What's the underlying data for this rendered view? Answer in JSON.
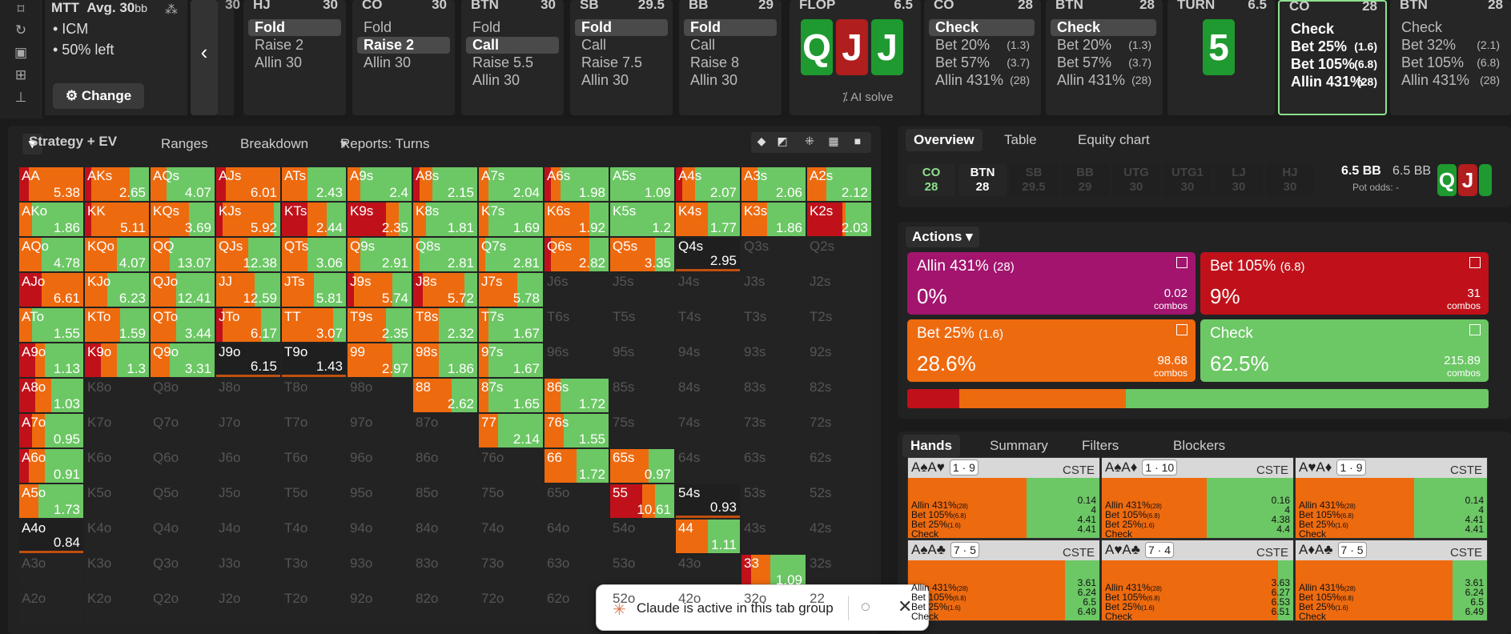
{
  "topbar": {
    "mtt": {
      "title": "MTT",
      "avg": "Avg. 30",
      "avg_unit": "bb",
      "bullets": [
        "• ICM",
        "• 50% left"
      ],
      "change": "Change"
    },
    "nav_stack": "30",
    "columns": [
      {
        "pos": "HJ",
        "stack": "30",
        "actions": [
          {
            "t": "Fold",
            "sel": true
          },
          {
            "t": "Raise 2"
          },
          {
            "t": "Allin 30"
          }
        ]
      },
      {
        "pos": "CO",
        "stack": "30",
        "actions": [
          {
            "t": "Fold"
          },
          {
            "t": "Raise 2",
            "sel": true
          },
          {
            "t": "Allin 30"
          }
        ]
      },
      {
        "pos": "BTN",
        "stack": "30",
        "actions": [
          {
            "t": "Fold"
          },
          {
            "t": "Call",
            "sel": true
          },
          {
            "t": "Raise 5.5"
          },
          {
            "t": "Allin 30"
          }
        ]
      },
      {
        "pos": "SB",
        "stack": "29.5",
        "actions": [
          {
            "t": "Fold",
            "sel": true
          },
          {
            "t": "Call"
          },
          {
            "t": "Raise 7.5"
          },
          {
            "t": "Allin 30"
          }
        ]
      },
      {
        "pos": "BB",
        "stack": "29",
        "actions": [
          {
            "t": "Fold",
            "sel": true
          },
          {
            "t": "Call"
          },
          {
            "t": "Raise 8"
          },
          {
            "t": "Allin 30"
          }
        ]
      }
    ],
    "flop": {
      "label": "FLOP",
      "pot": "6.5",
      "cards": [
        {
          "r": "Q",
          "c": "#1e9a30"
        },
        {
          "r": "J",
          "c": "#b01e1e"
        },
        {
          "r": "J",
          "c": "#1e9a30"
        }
      ],
      "ai": "AI solve"
    },
    "postflop": [
      {
        "pos": "CO",
        "stack": "28",
        "actions": [
          {
            "t": "Check",
            "sel": true
          },
          {
            "t": "Bet 20%",
            "s": "(1.3)"
          },
          {
            "t": "Bet 57%",
            "s": "(3.7)"
          },
          {
            "t": "Allin 431%",
            "s": "(28)"
          }
        ]
      },
      {
        "pos": "BTN",
        "stack": "28",
        "actions": [
          {
            "t": "Check",
            "sel": true
          },
          {
            "t": "Bet 20%",
            "s": "(1.3)"
          },
          {
            "t": "Bet 57%",
            "s": "(3.7)"
          },
          {
            "t": "Allin 431%",
            "s": "(28)"
          }
        ]
      }
    ],
    "turn": {
      "label": "TURN",
      "pot": "6.5",
      "card": "5",
      "color": "#1e9a30"
    },
    "active": {
      "pos": "CO",
      "stack": "28",
      "actions": [
        {
          "t": "Check"
        },
        {
          "t": "Bet 25%",
          "s": "(1.6)"
        },
        {
          "t": "Bet 105%",
          "s": "(6.8)"
        },
        {
          "t": "Allin 431%",
          "s": "(28)"
        }
      ]
    },
    "last": {
      "pos": "BTN",
      "stack": "28",
      "actions": [
        {
          "t": "Check"
        },
        {
          "t": "Bet 32%",
          "s": "(2.1)"
        },
        {
          "t": "Bet 105%",
          "s": "(6.8)"
        },
        {
          "t": "Allin 431%",
          "s": "(28)"
        }
      ]
    }
  },
  "grid_tabs": {
    "strategy": "Strategy + EV",
    "ranges": "Ranges",
    "breakdown": "Breakdown",
    "reports": "Reports: Turns"
  },
  "grid": [
    [
      "AA|5.38|r15o85",
      "AKs|2.65|r10o60g30",
      "AQs|4.07|o25g75",
      "AJs|6.01|r15o85",
      "ATs|2.43|o40g60",
      "A9s|2.4|o20g80",
      "A8s|2.15|r10o20g70",
      "A7s|2.04|o15g85",
      "A6s|1.98|r10o15g75",
      "A5s|1.09|g100",
      "A4s|2.07|r10o20g70",
      "A3s|2.06|o25g75",
      "A2s|2.12|o30g70"
    ],
    [
      "AKo|1.86|o20g80",
      "KK|5.11|r10o90",
      "KQs|3.69|o60g40",
      "KJs|5.92|r10o80g10",
      "KTs|2.44|r40o30g30",
      "K9s|2.35|r60o20g20",
      "K8s|1.81|o20g80",
      "K7s|1.69|o15g85",
      "K6s|1.92|o70g30",
      "K5s|1.2|g100",
      "K4s|1.77|o50g50",
      "K3s|1.86|o40g60",
      "K2s|2.03|r55o5g40"
    ],
    [
      "AQo|4.78|o35g65",
      "KQo|4.07|o50g50",
      "QQ|13.07|o30g70",
      "QJs|12.38|o50g50",
      "QTs|3.06|o40g60",
      "Q9s|2.91|o20g80",
      "Q8s|2.81|o10g90",
      "Q7s|2.81|o10g90",
      "Q6s|2.82|r10o60g30",
      "Q5s|3.35|o70g30",
      "Q4s|2.95|d",
      "Q3s||e",
      "Q2s||e"
    ],
    [
      "AJo|6.61|r35o65",
      "KJo|6.23|o35g65",
      "QJo|12.41|o40g60",
      "JJ|12.59|o60g40",
      "JTs|5.81|o50g50",
      "J9s|5.74|r10o60g30",
      "J8s|5.72|r15o65g20",
      "J7s|5.78|o60g40",
      "J6s||e",
      "J5s||e",
      "J4s||e",
      "J3s||e",
      "J2s||e"
    ],
    [
      "ATo|1.55|o20g80",
      "KTo|1.59|o55g45",
      "QTo|3.44|o40g60",
      "JTo|6.17|r10o60g30",
      "TT|3.07|o80g20",
      "T9s|2.35|o60g40",
      "T8s|2.32|o40g60",
      "T7s|1.67|o15g85",
      "T6s||e",
      "T5s||e",
      "T4s||e",
      "T3s||e",
      "T2s||e"
    ],
    [
      "A9o|1.13|r25o15g60",
      "K9o|1.3|r25o25g50",
      "Q9o|3.31|o30g70",
      "J9o|6.15|d",
      "T9o|1.43|d",
      "99|2.97|o70g30",
      "98s|1.86|o40g60",
      "97s|1.67|o15g85",
      "96s||e",
      "95s||e",
      "94s||e",
      "93s||e",
      "92s||e"
    ],
    [
      "A8o|1.03|r25o25g50",
      "K8o||e",
      "Q8o||e",
      "J8o||e",
      "T8o||e",
      "98o||e",
      "88|2.62|o60g40",
      "87s|1.65|o15g85",
      "86s|1.72|o25g75",
      "85s||e",
      "84s||e",
      "83s||e",
      "82s||e"
    ],
    [
      "A7o|0.95|r20o20g60",
      "K7o||e",
      "Q7o||e",
      "J7o||e",
      "T7o||e",
      "97o||e",
      "87o||e",
      "77|2.14|o30g70",
      "76s|1.55|o30g70",
      "75s||e",
      "74s||e",
      "73s||e",
      "72s||e"
    ],
    [
      "A6o|0.91|r15o25g60",
      "K6o||e",
      "Q6o||e",
      "J6o||e",
      "T6o||e",
      "96o||e",
      "86o||e",
      "76o||e",
      "66|1.72|o50g50",
      "65s|0.97|o60g40",
      "64s||e",
      "63s||e",
      "62s||e"
    ],
    [
      "A5o|1.73|o30g70",
      "K5o||e",
      "Q5o||e",
      "J5o||e",
      "T5o||e",
      "95o||e",
      "85o||e",
      "75o||e",
      "65o||e",
      "55|10.61|r50o20g30",
      "54s|0.93|d",
      "53s||e",
      "52s||e"
    ],
    [
      "A4o|0.84|d",
      "K4o||e",
      "Q4o||e",
      "J4o||e",
      "T4o||e",
      "94o||e",
      "84o||e",
      "74o||e",
      "64o||e",
      "54o||e",
      "44|1.11|o50g50",
      "43s||e",
      "42s||e"
    ],
    [
      "A3o||e",
      "K3o||e",
      "Q3o||e",
      "J3o||e",
      "T3o||e",
      "93o||e",
      "83o||e",
      "73o||e",
      "63o||e",
      "53o||e",
      "43o||e",
      "33|1.09|r15o30g55",
      "32s||e"
    ],
    [
      "A2o||e",
      "K2o||e",
      "Q2o||e",
      "J2o||e",
      "T2o||e",
      "92o||e",
      "82o||e",
      "72o||e",
      "62o||e",
      "52o||e",
      "42o||e",
      "32o||e",
      "22||e"
    ]
  ],
  "right": {
    "tabs": [
      "Overview",
      "Table",
      "Equity chart"
    ],
    "positions": [
      {
        "p": "CO",
        "s": "28",
        "on": true
      },
      {
        "p": "BTN",
        "s": "28",
        "on": true
      },
      {
        "p": "SB",
        "s": "29.5"
      },
      {
        "p": "BB",
        "s": "29"
      },
      {
        "p": "UTG",
        "s": "30"
      },
      {
        "p": "UTG1",
        "s": "30"
      },
      {
        "p": "LJ",
        "s": "30"
      },
      {
        "p": "HJ",
        "s": "30"
      }
    ],
    "pot": "6.5 BB",
    "pot2": "6.5 BB",
    "pot_odds": "Pot odds: -",
    "actions_label": "Actions",
    "actions": [
      {
        "name": "Allin 431%",
        "sz": "(28)",
        "pct": "0%",
        "combos": "0.02",
        "color": "#a2146e"
      },
      {
        "name": "Bet 105%",
        "sz": "(6.8)",
        "pct": "9%",
        "combos": "31",
        "color": "#c0111a"
      },
      {
        "name": "Bet 25%",
        "sz": "(1.6)",
        "pct": "28.6%",
        "combos": "98.68",
        "color": "#ee6a0f"
      },
      {
        "name": "Check",
        "sz": "",
        "pct": "62.5%",
        "combos": "215.89",
        "color": "#6cc765"
      }
    ],
    "combos_word": "combos",
    "freq": [
      9,
      28.6,
      62.5
    ],
    "hands_tabs": [
      "Hands",
      "Summary",
      "Filters",
      "Blockers"
    ],
    "hands": [
      {
        "cards": "A♠A♥",
        "b1": "1",
        "b2": "9",
        "cs": "CSTE",
        "vals": [
          "0.14",
          "4",
          "4.41",
          "4.41"
        ],
        "f": [
          0,
          0,
          62,
          38
        ]
      },
      {
        "cards": "A♠A♦",
        "b1": "1",
        "b2": "10",
        "cs": "CSTE",
        "vals": [
          "0.16",
          "4",
          "4.38",
          "4.4"
        ],
        "f": [
          0,
          0,
          55,
          45
        ]
      },
      {
        "cards": "A♥A♦",
        "b1": "1",
        "b2": "9",
        "cs": "CSTE",
        "vals": [
          "0.14",
          "4",
          "4.41",
          "4.41"
        ],
        "f": [
          0,
          0,
          62,
          38
        ]
      },
      {
        "cards": "A♠A♣",
        "b1": "7",
        "b2": "5",
        "cs": "CSTE",
        "vals": [
          "3.61",
          "6.24",
          "6.5",
          "6.49"
        ],
        "f": [
          0,
          0,
          82,
          18
        ]
      },
      {
        "cards": "A♥A♣",
        "b1": "7",
        "b2": "4",
        "cs": "CSTE",
        "vals": [
          "3.63",
          "6.27",
          "6.53",
          "6.51"
        ],
        "f": [
          0,
          0,
          92,
          8
        ]
      },
      {
        "cards": "A♦A♣",
        "b1": "7",
        "b2": "5",
        "cs": "CSTE",
        "vals": [
          "3.61",
          "6.24",
          "6.5",
          "6.49"
        ],
        "f": [
          0,
          0,
          82,
          18
        ]
      }
    ],
    "hand_labels": [
      "Allin 431%",
      "Bet 105%",
      "Bet 25%",
      "Check"
    ],
    "hand_sizes": [
      "(28)",
      "(6.8)",
      "(1.6)",
      ""
    ]
  },
  "toast": {
    "text": "Claude is active in this tab group"
  }
}
